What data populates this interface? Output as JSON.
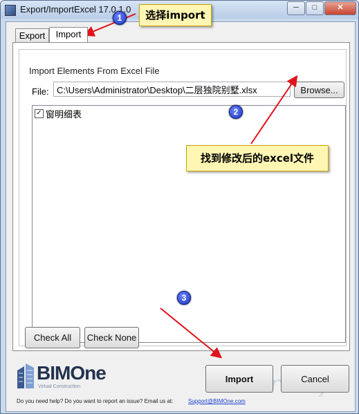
{
  "window": {
    "title": "Export/ImportExcel 17.0.1.0",
    "min_glyph": "─",
    "max_glyph": "□",
    "close_glyph": "✕"
  },
  "tabs": [
    {
      "label": "Export",
      "active": false
    },
    {
      "label": "Import",
      "active": true
    }
  ],
  "import_panel": {
    "group_title": "Import Elements From Excel File",
    "file_label": "File:",
    "file_value": "C:\\Users\\Administrator\\Desktop\\二层独院别墅.xlsx",
    "browse_label": "Browse...",
    "elements": [
      {
        "label": "窗明细表",
        "checked": true,
        "check_glyph": "✓"
      }
    ],
    "check_all_label": "Check All",
    "check_none_label": "Check None"
  },
  "footer": {
    "logo_text": "BIMOne",
    "logo_tagline": "Virtual Construction",
    "help_text": "Do you need help? Do you want to report an issue? Email us at:",
    "help_link": "Support@BIMOne.com",
    "import_label": "Import",
    "cancel_label": "Cancel",
    "watermark": "taiturisoft"
  },
  "annotations": {
    "step1_text": "选择import",
    "step2_text": "找到修改后的excel文件",
    "badges": [
      "1",
      "2",
      "3"
    ],
    "arrow_color": "#e0141c",
    "callout_bg": "#fff6b3"
  }
}
